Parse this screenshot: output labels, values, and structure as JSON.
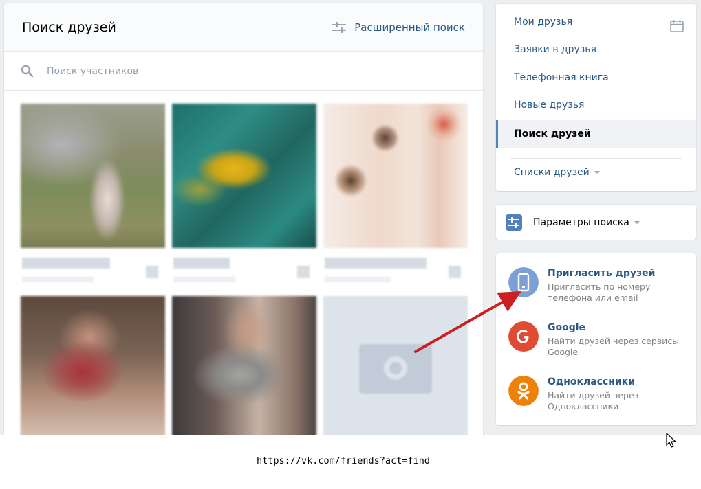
{
  "main": {
    "title": "Поиск друзей",
    "advanced_search_label": "Расширенный поиск",
    "search_placeholder": "Поиск участников"
  },
  "sidebar": {
    "items": [
      {
        "label": "Мои друзья"
      },
      {
        "label": "Заявки в друзья"
      },
      {
        "label": "Телефонная книга"
      },
      {
        "label": "Новые друзья"
      },
      {
        "label": "Поиск друзей",
        "active": true
      }
    ],
    "lists_label": "Списки друзей"
  },
  "search_params": {
    "label": "Параметры поиска"
  },
  "invite": {
    "items": [
      {
        "title": "Пригласить друзей",
        "desc": "Пригласить по номеру телефона или email",
        "icon": "phone-icon",
        "color": "#7aa0d6"
      },
      {
        "title": "Google",
        "desc": "Найти друзей через сервисы Google",
        "icon": "google-icon",
        "color": "#e04b33"
      },
      {
        "title": "Одноклассники",
        "desc": "Найти друзей через Одноклассники",
        "icon": "odnoklassniki-icon",
        "color": "#ee8208"
      }
    ]
  },
  "url": "https://vk.com/friends?act=find",
  "colors": {
    "link": "#2a5885",
    "accent": "#5181b8",
    "annotation_arrow": "#cc1f1f"
  }
}
